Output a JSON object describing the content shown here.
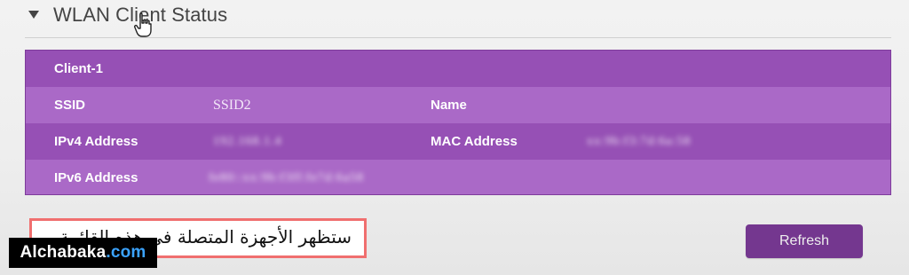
{
  "section": {
    "title": "WLAN Client Status",
    "collapse_icon": "triangle-down"
  },
  "client_table": {
    "heading": "Client-1",
    "rows": {
      "ssid": {
        "label": "SSID",
        "value": "SSID2"
      },
      "name": {
        "label": "Name"
      },
      "ipv4": {
        "label": "IPv4 Address",
        "value": "192.168.1.4"
      },
      "mac": {
        "label": "MAC Address",
        "value": "xx:9b:f3:7d:6a:58"
      },
      "ipv6": {
        "label": "IPv6 Address",
        "value": "fe80::xx:9b:f3ff:fe7d:6a58"
      }
    }
  },
  "caption": {
    "text": "ستظهر الأجهزة المتصلة في هذه القائمة"
  },
  "brand": {
    "main": "Alchabaka",
    "suffix": ".com"
  },
  "actions": {
    "refresh_label": "Refresh"
  },
  "colors": {
    "accent": "#9650b5",
    "accent_light": "#aa69c7",
    "button": "#74378f",
    "caption_border": "#f06f6f",
    "brand_suffix": "#3ba3ff"
  },
  "icons": {
    "header_pointer": "pointer-hand-icon"
  }
}
